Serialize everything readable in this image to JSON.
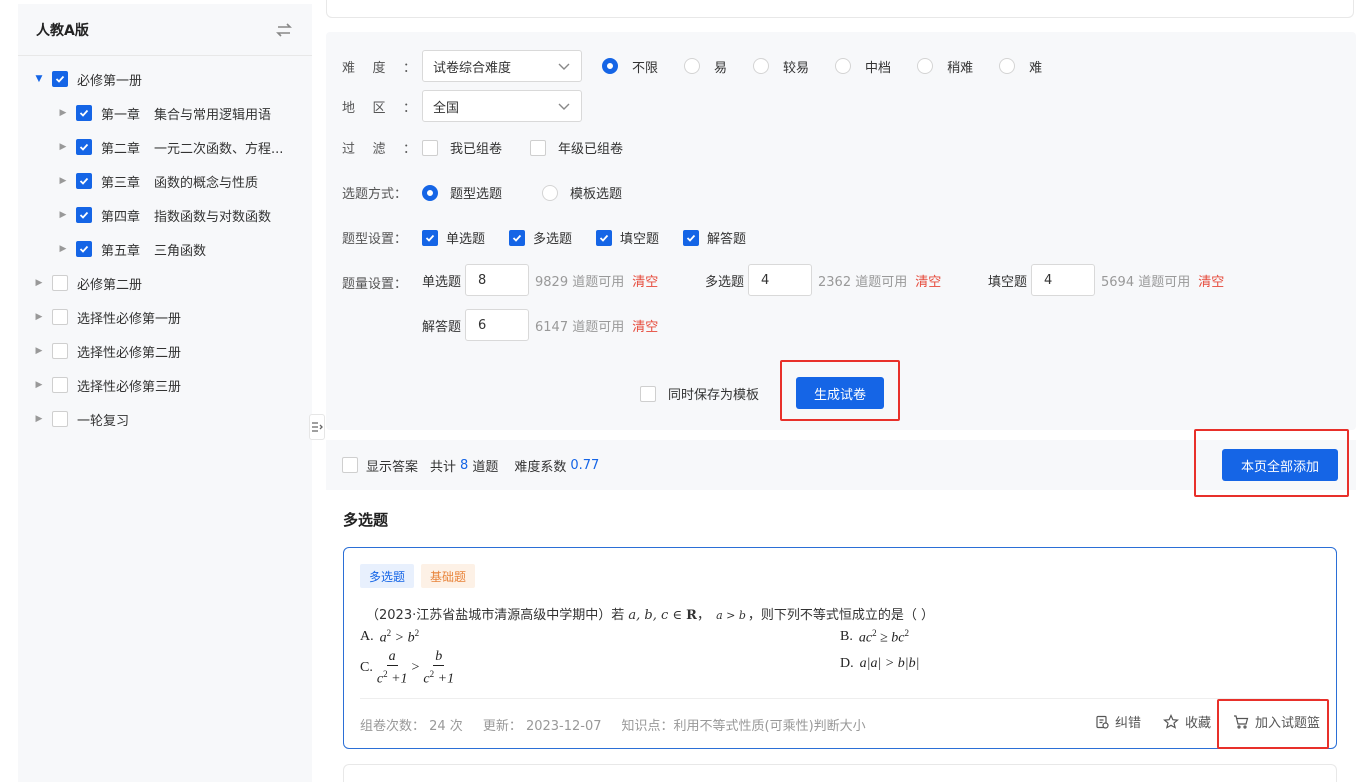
{
  "sidebar": {
    "title": "人教A版",
    "tree": [
      {
        "label": "必修第一册",
        "checked": true,
        "open": true
      },
      {
        "num": "第一章",
        "name": "集合与常用逻辑用语",
        "checked": true
      },
      {
        "num": "第二章",
        "name": "一元二次函数、方程...",
        "checked": true
      },
      {
        "num": "第三章",
        "name": "函数的概念与性质",
        "checked": true
      },
      {
        "num": "第四章",
        "name": "指数函数与对数函数",
        "checked": true
      },
      {
        "num": "第五章",
        "name": "三角函数",
        "checked": true
      },
      {
        "label": "必修第二册",
        "checked": false
      },
      {
        "label": "选择性必修第一册",
        "checked": false
      },
      {
        "label": "选择性必修第二册",
        "checked": false
      },
      {
        "label": "选择性必修第三册",
        "checked": false
      },
      {
        "label": "一轮复习",
        "checked": false
      }
    ]
  },
  "form": {
    "difficulty_label": [
      "难",
      "度",
      "："
    ],
    "difficulty_select": "试卷综合难度",
    "difficulty_options": [
      "不限",
      "易",
      "较易",
      "中档",
      "稍难",
      "难"
    ],
    "region_label": [
      "地",
      "区",
      "："
    ],
    "region_select": "全国",
    "filter_label": [
      "过",
      "滤",
      "："
    ],
    "filter_options": [
      "我已组卷",
      "年级已组卷"
    ],
    "method_label": "选题方式：",
    "method_options": [
      "题型选题",
      "模板选题"
    ],
    "types_label": "题型设置：",
    "types": [
      "单选题",
      "多选题",
      "填空题",
      "解答题"
    ],
    "qty_label": "题量设置：",
    "qty": [
      {
        "label": "单选题",
        "value": "8",
        "avail": "9829 道题可用",
        "clear": "清空"
      },
      {
        "label": "多选题",
        "value": "4",
        "avail": "2362 道题可用",
        "clear": "清空"
      },
      {
        "label": "填空题",
        "value": "4",
        "avail": "5694 道题可用",
        "clear": "清空"
      },
      {
        "label": "解答题",
        "value": "6",
        "avail": "6147 道题可用",
        "clear": "清空"
      }
    ],
    "save_template": "同时保存为模板",
    "generate": "生成试卷"
  },
  "results": {
    "show_answer": "显示答案",
    "total_prefix": "共计",
    "total": "8",
    "total_suffix": "道题",
    "difficulty_label": "难度系数",
    "difficulty_value": "0.77",
    "add_all": "本页全部添加"
  },
  "section_title": "多选题",
  "question": {
    "tag_type": "多选题",
    "tag_level": "基础题",
    "stem_prefix": "（2023·江苏省盐城市清源高级中学期中）若",
    "stem_vars": "a, b, c ∈ ",
    "stem_set": "R",
    "stem_cond": "a > b",
    "stem_suffix": "，则下列不等式恒成立的是（ ）",
    "opt_a": "A.",
    "opt_b": "B.",
    "opt_c": "C.",
    "opt_d": "D.",
    "meta_count": "组卷次数： 24 次",
    "meta_update": "更新： 2023-12-07",
    "meta_point": "知识点：利用不等式性质(可乘性)判断大小",
    "act_report": "纠错",
    "act_fav": "收藏",
    "act_add": "加入试题篮"
  },
  "colors": {
    "accent": "#1565e6",
    "danger": "#e64a3b",
    "highlight": "#e8302a"
  }
}
